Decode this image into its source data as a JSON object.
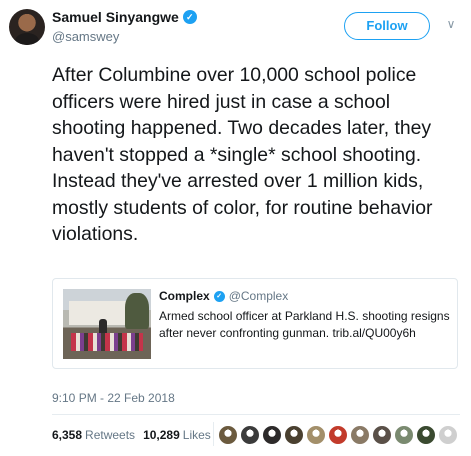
{
  "author": {
    "name": "Samuel Sinyangwe",
    "handle": "@samswey",
    "verified_icon": "verified-icon",
    "avatar_colors": [
      "#9a6a4a",
      "#2a2320"
    ]
  },
  "follow_button": {
    "label": "Follow",
    "color": "#1da1f2"
  },
  "menu_caret": {
    "icon": "chevron-down-icon",
    "glyph": "∨"
  },
  "tweet": {
    "text": "After Columbine over 10,000 school police officers were hired just in case a school shooting happened. Two decades later, they haven't stopped a *single* school shooting. Instead they've arrested over 1 million kids, mostly students of color, for routine behavior violations."
  },
  "quoted_tweet": {
    "name": "Complex",
    "handle": "@Complex",
    "text": "Armed school officer at Parkland H.S. shooting resigns after never confronting gunman. trib.al/QU00y6h"
  },
  "timestamp": "9:10 PM - 22 Feb 2018",
  "stats": {
    "retweets_count": "6,358",
    "retweets_label": "Retweets",
    "likes_count": "10,289",
    "likes_label": "Likes"
  },
  "likers": [
    {
      "name": "liker-avatar-1",
      "color": "#6b5a3e"
    },
    {
      "name": "liker-avatar-2",
      "color": "#3b3b3b"
    },
    {
      "name": "liker-avatar-3",
      "color": "#2d2a2a"
    },
    {
      "name": "liker-avatar-4",
      "color": "#4a4030"
    },
    {
      "name": "liker-avatar-5",
      "color": "#a38f6a"
    },
    {
      "name": "liker-avatar-6",
      "color": "#c23b2b"
    },
    {
      "name": "liker-avatar-7",
      "color": "#8a7a66"
    },
    {
      "name": "liker-avatar-8",
      "color": "#5a5048"
    },
    {
      "name": "liker-avatar-9",
      "color": "#7a8a70"
    },
    {
      "name": "liker-avatar-10",
      "color": "#3a4a30"
    },
    {
      "name": "liker-avatar-11",
      "color": "#cfcfcf"
    }
  ],
  "colors": {
    "accent": "#1da1f2",
    "text": "#14171a",
    "secondary_text": "#657786",
    "border": "#e1e8ed"
  }
}
